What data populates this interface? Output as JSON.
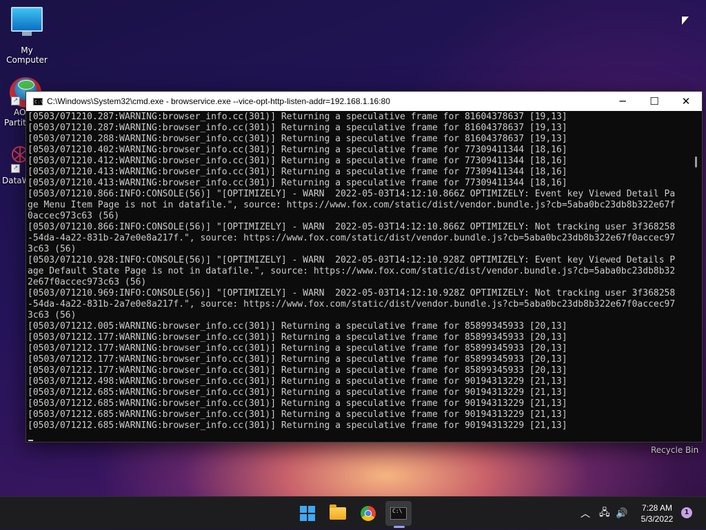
{
  "desktop": {
    "icons": [
      {
        "label": "My Computer"
      },
      {
        "label": "AO",
        "label2": "Partiti"
      },
      {
        "label": "DataW"
      }
    ],
    "recycle_label": "Recycle Bin",
    "shortcut_glyph": "↗"
  },
  "window": {
    "icon_glyph": "C:\\",
    "title": "C:\\Windows\\System32\\cmd.exe - browservice.exe  --vice-opt-http-listen-addr=192.168.1.16:80",
    "minimize_glyph": "─",
    "maximize_glyph": "☐",
    "close_glyph": "✕"
  },
  "console": {
    "lines": [
      "[0503/071210.287:WARNING:browser_info.cc(301)] Returning a speculative frame for 81604378637 [19,13]",
      "[0503/071210.287:WARNING:browser_info.cc(301)] Returning a speculative frame for 81604378637 [19,13]",
      "[0503/071210.288:WARNING:browser_info.cc(301)] Returning a speculative frame for 81604378637 [19,13]",
      "[0503/071210.402:WARNING:browser_info.cc(301)] Returning a speculative frame for 77309411344 [18,16]",
      "[0503/071210.412:WARNING:browser_info.cc(301)] Returning a speculative frame for 77309411344 [18,16]",
      "[0503/071210.413:WARNING:browser_info.cc(301)] Returning a speculative frame for 77309411344 [18,16]",
      "[0503/071210.413:WARNING:browser_info.cc(301)] Returning a speculative frame for 77309411344 [18,16]",
      "[0503/071210.866:INFO:CONSOLE(56)] \"[OPTIMIZELY] - WARN  2022-05-03T14:12:10.866Z OPTIMIZELY: Event key Viewed Detail Pa",
      "ge Menu Item Page is not in datafile.\", source: https://www.fox.com/static/dist/vendor.bundle.js?cb=5aba0bc23db8b322e67f",
      "0accec973c63 (56)",
      "[0503/071210.866:INFO:CONSOLE(56)] \"[OPTIMIZELY] - WARN  2022-05-03T14:12:10.866Z OPTIMIZELY: Not tracking user 3f368258",
      "-54da-4a22-831b-2a7e0e8a217f.\", source: https://www.fox.com/static/dist/vendor.bundle.js?cb=5aba0bc23db8b322e67f0accec97",
      "3c63 (56)",
      "[0503/071210.928:INFO:CONSOLE(56)] \"[OPTIMIZELY] - WARN  2022-05-03T14:12:10.928Z OPTIMIZELY: Event key Viewed Details P",
      "age Default State Page is not in datafile.\", source: https://www.fox.com/static/dist/vendor.bundle.js?cb=5aba0bc23db8b32",
      "2e67f0accec973c63 (56)",
      "[0503/071210.969:INFO:CONSOLE(56)] \"[OPTIMIZELY] - WARN  2022-05-03T14:12:10.928Z OPTIMIZELY: Not tracking user 3f368258",
      "-54da-4a22-831b-2a7e0e8a217f.\", source: https://www.fox.com/static/dist/vendor.bundle.js?cb=5aba0bc23db8b322e67f0accec97",
      "3c63 (56)",
      "[0503/071212.005:WARNING:browser_info.cc(301)] Returning a speculative frame for 85899345933 [20,13]",
      "[0503/071212.177:WARNING:browser_info.cc(301)] Returning a speculative frame for 85899345933 [20,13]",
      "[0503/071212.177:WARNING:browser_info.cc(301)] Returning a speculative frame for 85899345933 [20,13]",
      "[0503/071212.177:WARNING:browser_info.cc(301)] Returning a speculative frame for 85899345933 [20,13]",
      "[0503/071212.177:WARNING:browser_info.cc(301)] Returning a speculative frame for 85899345933 [20,13]",
      "[0503/071212.498:WARNING:browser_info.cc(301)] Returning a speculative frame for 90194313229 [21,13]",
      "[0503/071212.685:WARNING:browser_info.cc(301)] Returning a speculative frame for 90194313229 [21,13]",
      "[0503/071212.685:WARNING:browser_info.cc(301)] Returning a speculative frame for 90194313229 [21,13]",
      "[0503/071212.685:WARNING:browser_info.cc(301)] Returning a speculative frame for 90194313229 [21,13]",
      "[0503/071212.685:WARNING:browser_info.cc(301)] Returning a speculative frame for 90194313229 [21,13]"
    ]
  },
  "taskbar": {
    "term_glyph": "C:\\",
    "tray": {
      "chevron_glyph": "︿",
      "network_glyph": "🖧",
      "volume_glyph": "🔊"
    },
    "time": "7:28 AM",
    "date": "5/3/2022",
    "notification_count": "1"
  }
}
